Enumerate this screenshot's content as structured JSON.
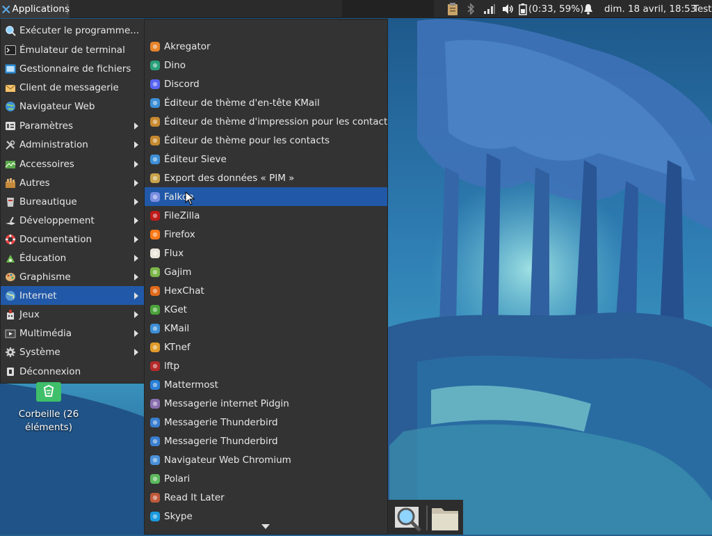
{
  "panel": {
    "applications_label": "Applications",
    "battery_text": "(0:33, 59%)",
    "clock": "dim. 18 avril, 18:53",
    "user": "Test"
  },
  "menu": {
    "items": [
      {
        "label": "Exécuter le programme...",
        "icon": "search-icon",
        "submenu": false
      },
      {
        "label": "Émulateur de terminal",
        "icon": "terminal-icon",
        "submenu": false
      },
      {
        "label": "Gestionnaire de fichiers",
        "icon": "file-manager-icon",
        "submenu": false
      },
      {
        "label": "Client de messagerie",
        "icon": "mail-client-icon",
        "submenu": false
      },
      {
        "label": "Navigateur Web",
        "icon": "web-browser-icon",
        "submenu": false
      },
      {
        "label": "Paramètres",
        "icon": "settings-icon",
        "submenu": true
      },
      {
        "label": "Administration",
        "icon": "tools-icon",
        "submenu": true
      },
      {
        "label": "Accessoires",
        "icon": "accessories-icon",
        "submenu": true
      },
      {
        "label": "Autres",
        "icon": "others-icon",
        "submenu": true
      },
      {
        "label": "Bureautique",
        "icon": "office-icon",
        "submenu": true
      },
      {
        "label": "Développement",
        "icon": "development-icon",
        "submenu": true
      },
      {
        "label": "Documentation",
        "icon": "help-lifebuoy-icon",
        "submenu": true
      },
      {
        "label": "Éducation",
        "icon": "education-icon",
        "submenu": true
      },
      {
        "label": "Graphisme",
        "icon": "graphics-palette-icon",
        "submenu": true
      },
      {
        "label": "Internet",
        "icon": "globe-icon",
        "submenu": true,
        "active": true
      },
      {
        "label": "Jeux",
        "icon": "games-icon",
        "submenu": true
      },
      {
        "label": "Multimédia",
        "icon": "multimedia-icon",
        "submenu": true
      },
      {
        "label": "Système",
        "icon": "system-gear-icon",
        "submenu": true
      },
      {
        "label": "Déconnexion",
        "icon": "logout-icon",
        "submenu": false
      }
    ]
  },
  "submenu": {
    "items": [
      {
        "label": "Akregator",
        "icon": "rss-icon",
        "color": "#e8832a"
      },
      {
        "label": "Dino",
        "icon": "dino-icon",
        "color": "#2aa07a"
      },
      {
        "label": "Discord",
        "icon": "discord-icon",
        "color": "#5865f2"
      },
      {
        "label": "Éditeur de thème d'en-tête KMail",
        "icon": "kmail-theme-icon",
        "color": "#3d8fd6"
      },
      {
        "label": "Éditeur de thème d'impression pour les contacts",
        "icon": "contacts-theme-icon",
        "color": "#c7892e"
      },
      {
        "label": "Éditeur de thème pour les contacts",
        "icon": "contacts-theme-icon",
        "color": "#c7892e"
      },
      {
        "label": "Éditeur Sieve",
        "icon": "sieve-icon",
        "color": "#3d8fd6"
      },
      {
        "label": "Export des données « PIM »",
        "icon": "pim-export-icon",
        "color": "#c9a24a"
      },
      {
        "label": "Falkon",
        "icon": "falkon-icon",
        "color": "#7b8ee0",
        "active": true
      },
      {
        "label": "FileZilla",
        "icon": "filezilla-icon",
        "color": "#bf1b1b"
      },
      {
        "label": "Firefox",
        "icon": "firefox-icon",
        "color": "#ff7a18"
      },
      {
        "label": "Flux",
        "icon": "flux-icon",
        "color": "#e9e4d8"
      },
      {
        "label": "Gajim",
        "icon": "gajim-icon",
        "color": "#7ab648"
      },
      {
        "label": "HexChat",
        "icon": "hexchat-icon",
        "color": "#e06a1b"
      },
      {
        "label": "KGet",
        "icon": "kget-icon",
        "color": "#4aa33a"
      },
      {
        "label": "KMail",
        "icon": "kmail-icon",
        "color": "#3d8fd6"
      },
      {
        "label": "KTnef",
        "icon": "ktnef-icon",
        "color": "#e09b2a"
      },
      {
        "label": "lftp",
        "icon": "lftp-icon",
        "color": "#b52a2a"
      },
      {
        "label": "Mattermost",
        "icon": "mattermost-icon",
        "color": "#2a7fd6"
      },
      {
        "label": "Messagerie internet Pidgin",
        "icon": "pidgin-icon",
        "color": "#8a6fb0"
      },
      {
        "label": "Messagerie Thunderbird",
        "icon": "thunderbird-icon",
        "color": "#3a7fd0"
      },
      {
        "label": "Messagerie Thunderbird",
        "icon": "thunderbird-icon",
        "color": "#3a7fd0"
      },
      {
        "label": "Navigateur Web Chromium",
        "icon": "chromium-icon",
        "color": "#4a90d9"
      },
      {
        "label": "Polari",
        "icon": "polari-icon",
        "color": "#5cb85c"
      },
      {
        "label": "Read It Later",
        "icon": "read-it-later-icon",
        "color": "#c05a3a"
      },
      {
        "label": "Skype",
        "icon": "skype-icon",
        "color": "#1a9be0"
      }
    ]
  },
  "desktop": {
    "trash_label": "Corbeille (26 éléments)"
  }
}
